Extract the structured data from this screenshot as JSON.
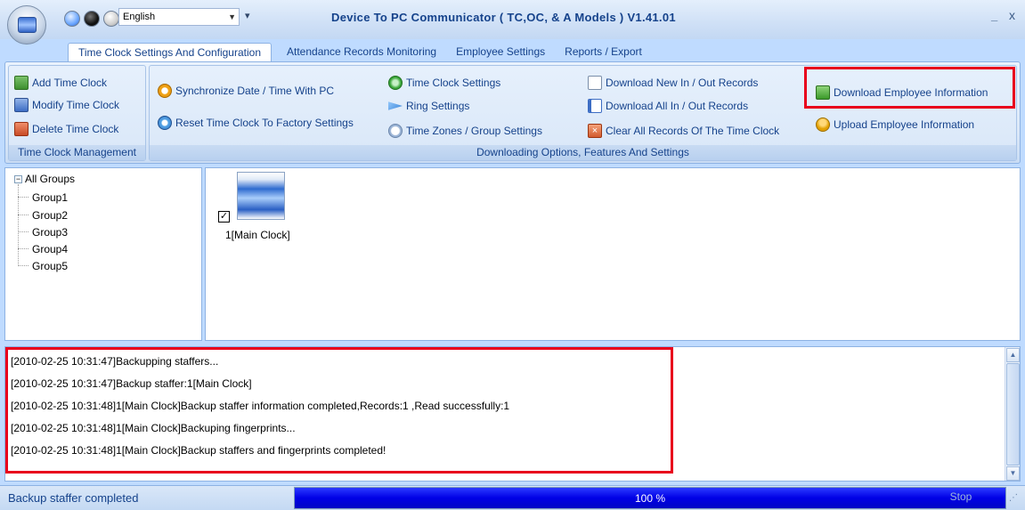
{
  "title_bar": {
    "language": "English",
    "title": "Device To PC Communicator ( TC,OC, & A Models ) V1.41.01",
    "minimize": "_",
    "close": "x"
  },
  "tabs": [
    {
      "label": "Time Clock Settings And Configuration",
      "active": true
    },
    {
      "label": "Attendance Records Monitoring"
    },
    {
      "label": "Employee Settings"
    },
    {
      "label": "Reports / Export"
    }
  ],
  "ribbon": {
    "management": {
      "label": "Time Clock Management",
      "add": "Add Time Clock",
      "modify": "Modify Time Clock",
      "delete": "Delete Time Clock"
    },
    "options": {
      "label": "Downloading Options, Features And Settings",
      "sync": "Synchronize Date / Time With PC",
      "reset": "Reset Time Clock To Factory Settings",
      "clock_settings": "Time Clock Settings",
      "ring_settings": "Ring Settings",
      "time_zones": "Time Zones / Group Settings",
      "download_new": "Download New In / Out Records",
      "download_all": "Download All In / Out Records",
      "clear_all": "Clear All Records Of The Time Clock",
      "download_employee": "Download Employee Information",
      "upload_employee": "Upload Employee Information"
    }
  },
  "tree": {
    "root": "All Groups",
    "toggle": "−",
    "items": [
      "Group1",
      "Group2",
      "Group3",
      "Group4",
      "Group5"
    ]
  },
  "devices": [
    {
      "label": "1[Main Clock]",
      "checked": true,
      "check_glyph": "✓"
    }
  ],
  "log": [
    "[2010-02-25 10:31:47]Backupping staffers...",
    "[2010-02-25 10:31:47]Backup staffer:1[Main Clock]",
    "[2010-02-25 10:31:48]1[Main Clock]Backup staffer information completed,Records:1 ,Read successfully:1",
    "[2010-02-25 10:31:48]1[Main Clock]Backuping fingerprints...",
    "[2010-02-25 10:31:48]1[Main Clock]Backup staffers and fingerprints completed!"
  ],
  "status": {
    "text": "Backup staffer completed",
    "progress_percent": 100,
    "progress_label": "100 %",
    "stop": "Stop"
  },
  "colors": {
    "highlight": "#e8001c",
    "progress": "#0000e6",
    "accent": "#15428b"
  }
}
